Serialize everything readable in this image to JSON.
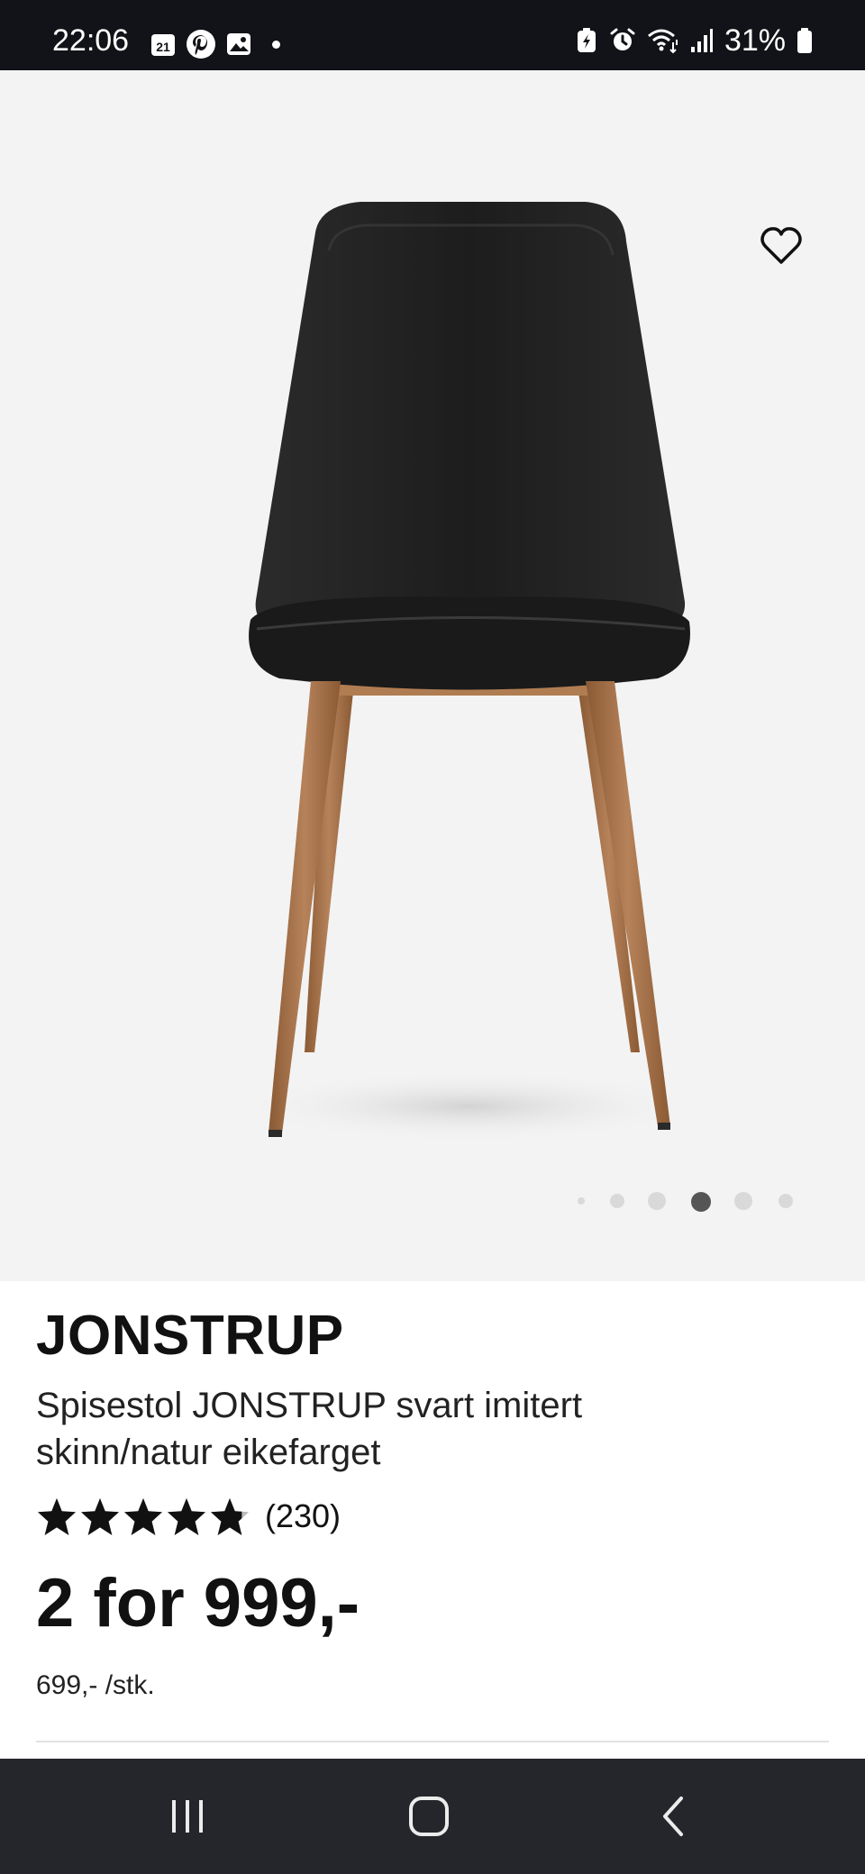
{
  "status_bar": {
    "time": "22:06",
    "calendar_day": "21",
    "battery": "31%",
    "left_icons": [
      "calendar-icon",
      "pinterest-icon",
      "gallery-icon",
      "notification-dot"
    ],
    "right_icons": [
      "battery-saver-icon",
      "alarm-icon",
      "wifi-icon",
      "signal-icon",
      "battery-icon"
    ]
  },
  "product": {
    "brand": "JONSTRUP",
    "subtitle": "Spisestol JONSTRUP svart imitert skinn/natur eikefarget",
    "rating_value": 4.8,
    "rating_max": 5,
    "review_count": "(230)",
    "price": "2 for 999,-",
    "unit_price": "699,- /stk."
  },
  "gallery": {
    "total_dots": 6,
    "active_index": 3,
    "wishlist_icon": "heart-outline-icon"
  },
  "navbar": {
    "recents": "recents-icon",
    "home": "home-icon",
    "back": "back-icon"
  },
  "colors": {
    "statusbar_bg": "#121318",
    "image_bg": "#f3f3f3",
    "text": "#111111",
    "navbar_bg": "#25262b",
    "dot_active": "#555555",
    "dot_inactive": "#d9d9d9"
  }
}
